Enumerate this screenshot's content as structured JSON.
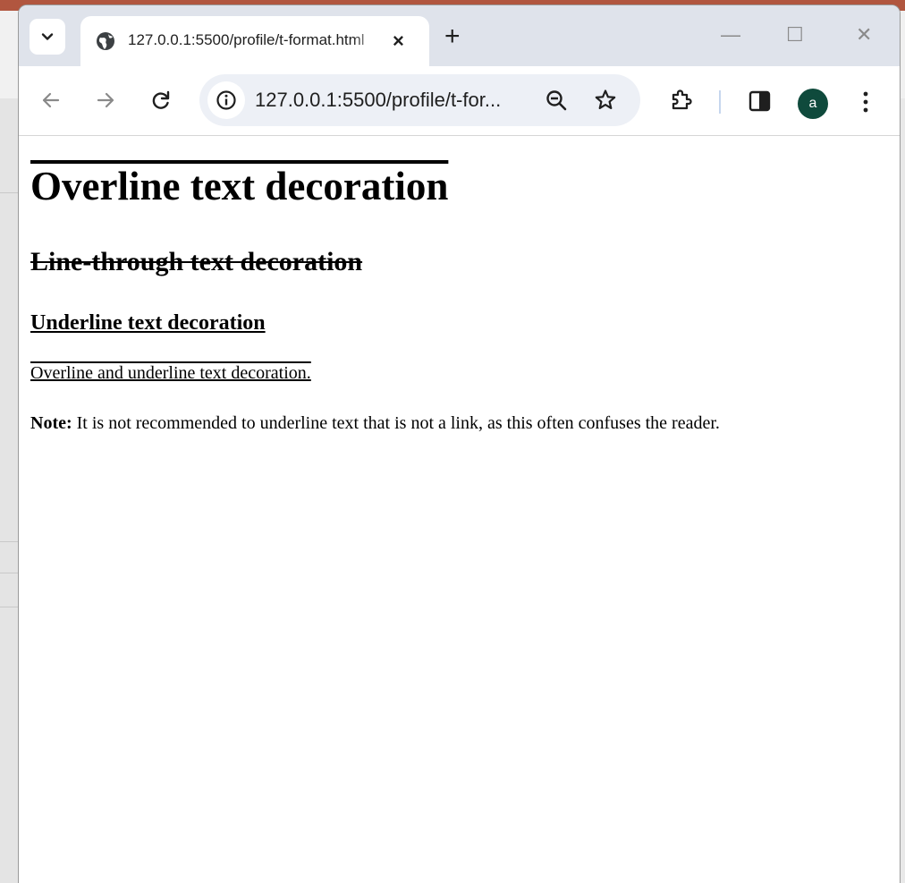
{
  "browser": {
    "tab_title": "127.0.0.1:5500/profile/t-format.html",
    "tab_close": "×",
    "new_tab": "+",
    "window_controls": {
      "minimize": "—",
      "maximize": "☐",
      "close": "✕"
    },
    "url": "127.0.0.1:5500/profile/t-for...",
    "avatar_letter": "a",
    "avatar_color": "#0f4a3c"
  },
  "page": {
    "heading_overline": "Overline text decoration",
    "heading_linethrough": "Line-through text decoration",
    "heading_underline": "Underline text decoration",
    "paragraph_over_under": "Overline and underline text decoration.",
    "note_label": "Note:",
    "note_text": " It is not recommended to underline text that is not a link, as this often confuses the reader."
  }
}
